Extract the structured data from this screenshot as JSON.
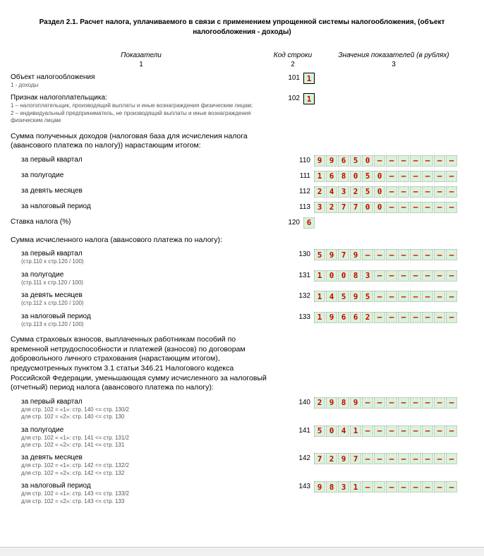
{
  "section_title": "Раздел 2.1. Расчет налога, уплачиваемого в связи с применением упрощенной системы налогообложения, (объект налогообложения - доходы)",
  "headers": {
    "col1": "Показатели",
    "col2": "Код строки",
    "col3": "Значения показателей (в рублях)",
    "sub1": "1",
    "sub2": "2",
    "sub3": "3"
  },
  "rows": {
    "r101": {
      "label": "Объект налогообложения",
      "sub": "1 - доходы",
      "code": "101",
      "value": "1",
      "width": 1,
      "boxed": true
    },
    "r102": {
      "label": "Признак налогоплательщика:",
      "sub": "1 – налогоплательщик, производящий выплаты и иные вознаграждения физическим лицам;\n2 – индивидуальный предприниматель, не производящий выплаты и иные вознаграждения физическим лицам",
      "code": "102",
      "value": "1",
      "width": 1,
      "boxed": true
    },
    "g1": "Сумма полученных доходов (налоговая база для исчисления налога (авансового платежа по налогу)) нарастающим итогом:",
    "r110": {
      "label": "за первый квартал",
      "code": "110",
      "value": "99650",
      "width": 12
    },
    "r111": {
      "label": "за полугодие",
      "code": "111",
      "value": "168050",
      "width": 12
    },
    "r112": {
      "label": "за девять месяцев",
      "code": "112",
      "value": "243250",
      "width": 12
    },
    "r113": {
      "label": "за налоговый период",
      "code": "113",
      "value": "327700",
      "width": 12
    },
    "r120": {
      "label": "Ставка налога (%)",
      "code": "120",
      "value": "6",
      "width": 1,
      "nobg_extra": true
    },
    "g2": "Сумма исчисленного налога (авансового платежа по налогу):",
    "r130": {
      "label": "за первый квартал",
      "sub": "(стр.110 x стр.120 / 100)",
      "code": "130",
      "value": "5979",
      "width": 12
    },
    "r131": {
      "label": "за полугодие",
      "sub": "(стр.111 x стр.120 / 100)",
      "code": "131",
      "value": "10083",
      "width": 12
    },
    "r132": {
      "label": "за девять месяцев",
      "sub": "(стр.112 x стр.120 / 100)",
      "code": "132",
      "value": "14595",
      "width": 12
    },
    "r133": {
      "label": "за налоговый период",
      "sub": "(стр.113 x стр.120 / 100)",
      "code": "133",
      "value": "19662",
      "width": 12
    },
    "g3": "Сумма страховых взносов, выплаченных работникам пособий по временной нетрудоспособности и платежей (взносов) по договорам добровольного личного страхования (нарастающим итогом), предусмотренных пунктом 3.1 статьи 346.21 Налогового кодекса Российской Федерации, уменьшающая сумму исчисленного за налоговый (отчетный) период налога (авансового платежа по налогу):",
    "r140": {
      "label": "за первый квартал",
      "sub": "для стр. 102 = «1»: стр. 140 <= стр. 130/2\nдля стр. 102 = «2»: стр. 140 <= стр. 130",
      "code": "140",
      "value": "2989",
      "width": 12
    },
    "r141": {
      "label": "за полугодие",
      "sub": "для стр. 102 = «1»: стр. 141 <= стр. 131/2\nдля стр. 102 = «2»: стр. 141 <= стр. 131",
      "code": "141",
      "value": "5041",
      "width": 12
    },
    "r142": {
      "label": "за девять месяцев",
      "sub": "для стр. 102 = «1»: стр. 142 <= стр. 132/2\nдля стр. 102 = «2»: стр. 142 <= стр. 132",
      "code": "142",
      "value": "7297",
      "width": 12
    },
    "r143": {
      "label": "за налоговый период",
      "sub": "для стр. 102 = «1»: стр. 143 <= стр. 133/2\nдля стр. 102 = «2»: стр. 143 <= стр. 133",
      "code": "143",
      "value": "9831",
      "width": 12
    }
  }
}
